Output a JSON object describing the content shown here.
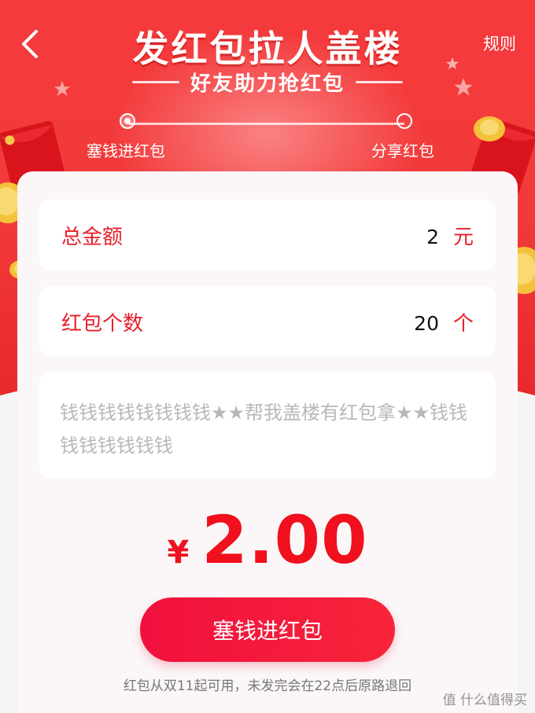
{
  "header": {
    "title": "发红包拉人盖楼",
    "subtitle": "好友助力抢红包",
    "rules_label": "规则"
  },
  "steps": [
    {
      "label": "塞钱进红包",
      "active": true
    },
    {
      "label": "分享红包",
      "active": false
    }
  ],
  "form": {
    "total": {
      "label": "总金额",
      "value": "2",
      "unit": "元"
    },
    "count": {
      "label": "红包个数",
      "value": "20",
      "unit": "个"
    },
    "message": "钱钱钱钱钱钱钱钱★★帮我盖楼有红包拿★★钱钱钱钱钱钱钱钱"
  },
  "amount": {
    "symbol": "¥",
    "value": "2.00"
  },
  "submit_label": "塞钱进红包",
  "footnote": "红包从双11起可用，未发完会在22点后原路退回",
  "watermark": "值 什么值得买",
  "colors": {
    "primary": "#f0101e",
    "hero": "#f23a3a",
    "card": "#fbf7f8"
  }
}
